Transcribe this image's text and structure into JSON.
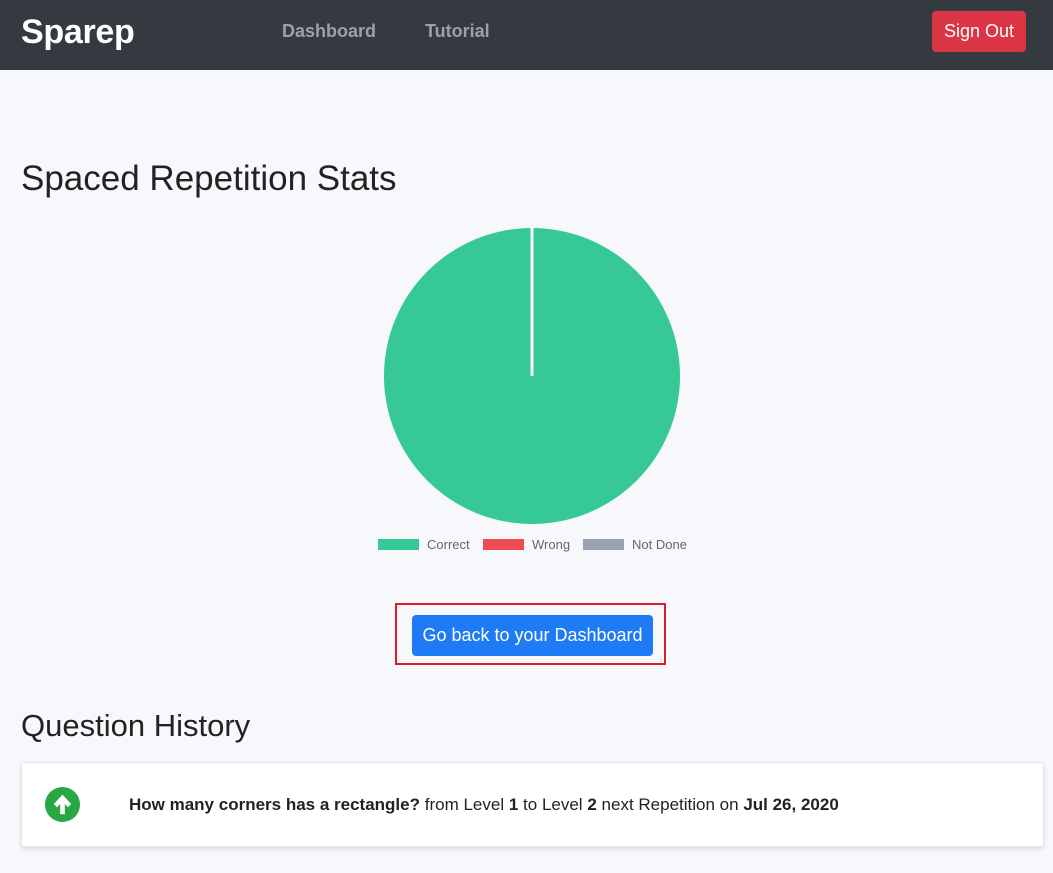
{
  "navbar": {
    "brand": "Sparep",
    "links": [
      "Dashboard",
      "Tutorial"
    ],
    "sign_out_label": "Sign Out"
  },
  "colors": {
    "navbar_bg": "#343a40",
    "danger": "#dc3545",
    "primary": "#1e7bf5",
    "correct": "#36c995",
    "wrong": "#ee4c55",
    "not_done": "#98a2b3",
    "success_icon": "#28a745"
  },
  "stats": {
    "title": "Spaced Repetition Stats",
    "back_button_label": "Go back to your Dashboard"
  },
  "chart_data": {
    "type": "pie",
    "categories": [
      "Correct",
      "Wrong",
      "Not Done"
    ],
    "values": [
      1,
      0,
      0
    ],
    "colors": [
      "#36c995",
      "#ee4c55",
      "#98a2b3"
    ],
    "legend": [
      "Correct",
      "Wrong",
      "Not Done"
    ],
    "legend_position": "bottom"
  },
  "history": {
    "title": "Question History",
    "items": [
      {
        "icon": "arrow-up-circle-icon",
        "question": "How many corners has a rectangle?",
        "from_text": "from Level",
        "from_level": "1",
        "to_text": "to Level",
        "to_level": "2",
        "next_text": "next Repetition on",
        "date": "Jul 26, 2020"
      }
    ]
  }
}
